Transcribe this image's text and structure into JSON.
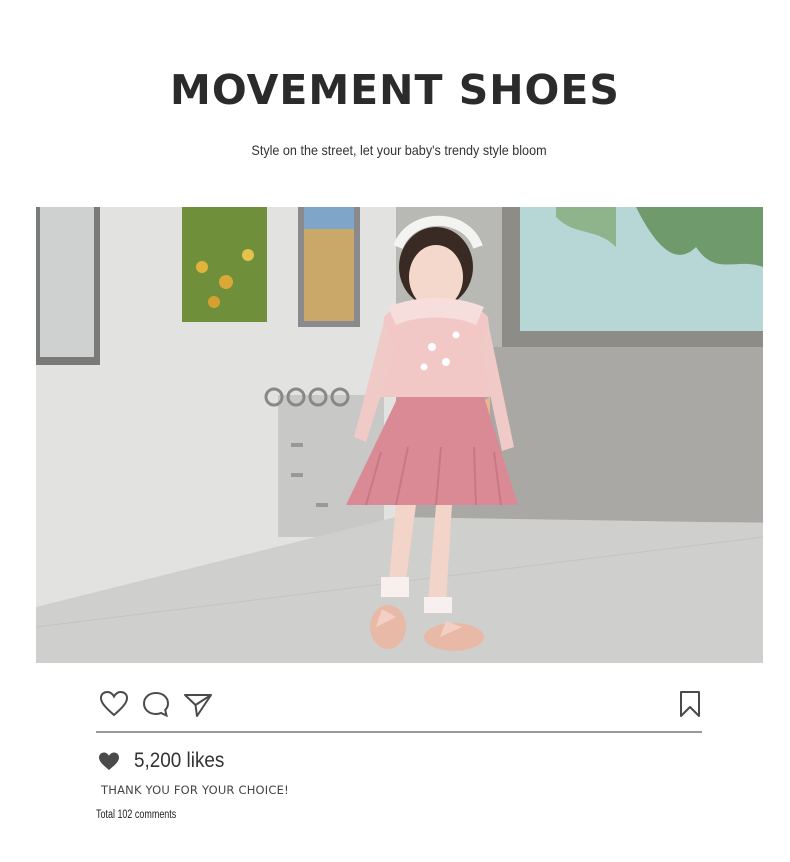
{
  "header": {
    "title": "MOVEMENT SHOES",
    "subtitle": "Style on the street, let your baby's trendy style bloom"
  },
  "post": {
    "image": "girl-in-pink-outfit-photo",
    "actions": {
      "like_icon": "heart-outline-icon",
      "comment_icon": "speech-bubble-icon",
      "share_icon": "paper-plane-icon",
      "save_icon": "bookmark-icon"
    },
    "likes_text": "5,200 likes",
    "caption": "THANK YOU FOR YOUR CHOICE!",
    "comments_text": "Total 102 comments"
  },
  "colors": {
    "title": "#2b2b2b",
    "icon_stroke": "#4a4a4a",
    "divider": "#9a9a9a",
    "skirt": "#d98a95",
    "bow": "#e8b892"
  }
}
